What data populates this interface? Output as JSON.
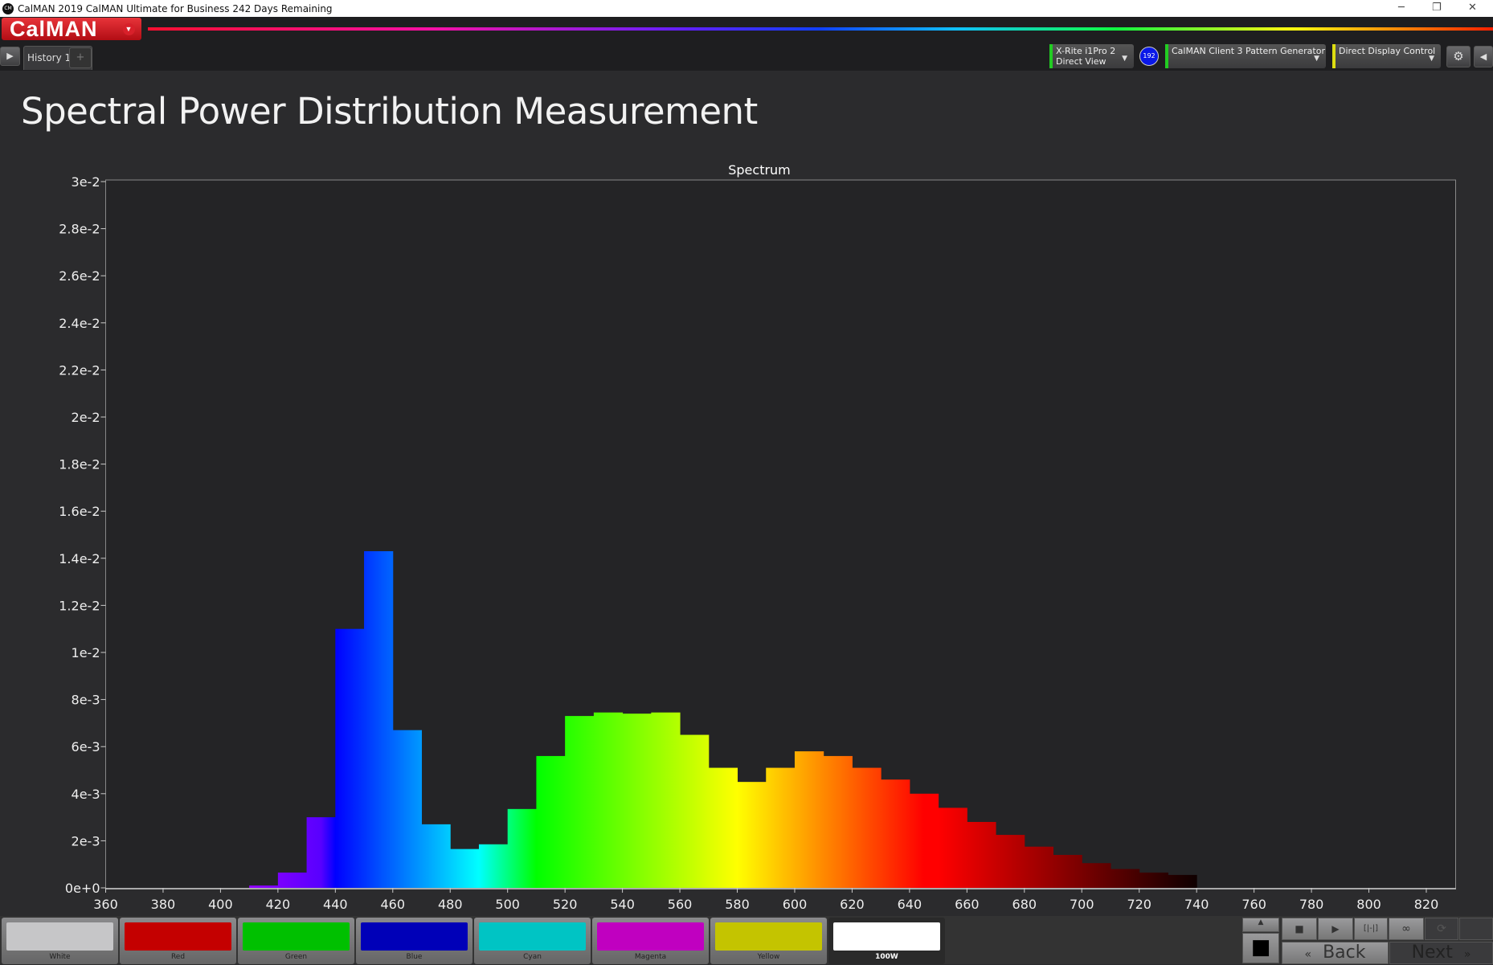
{
  "window": {
    "title": "CalMAN 2019 CalMAN Ultimate for Business 242 Days Remaining",
    "logo_text": "CM",
    "minimize": "─",
    "restore": "❐",
    "close": "✕"
  },
  "app": {
    "brand": "CalMAN",
    "brand_dropdown": "▼"
  },
  "tabs": {
    "play": "▶",
    "items": [
      {
        "label": "History 1"
      }
    ],
    "add": "+"
  },
  "devices": [
    {
      "line1": "X-Rite i1Pro 2",
      "line2": "Direct View",
      "status_color": "#22cc22"
    },
    {
      "line1": "CalMAN Client 3 Pattern Generator",
      "line2": "",
      "status_color": "#22cc22"
    },
    {
      "line1": "Direct Display Control",
      "line2": "",
      "status_color": "#dddd11"
    }
  ],
  "meter_badge": "192",
  "page_title": "Spectral Power Distribution Measurement",
  "chart_data": {
    "type": "bar",
    "title": "Spectrum",
    "xlabel": "",
    "ylabel": "",
    "xlim": [
      360,
      830
    ],
    "ylim": [
      0,
      0.03
    ],
    "x_ticks": [
      "360",
      "380",
      "400",
      "420",
      "440",
      "460",
      "480",
      "500",
      "520",
      "540",
      "560",
      "580",
      "600",
      "620",
      "640",
      "660",
      "680",
      "700",
      "720",
      "740",
      "760",
      "780",
      "800",
      "820"
    ],
    "y_ticks": [
      "0e+0",
      "2e-3",
      "4e-3",
      "6e-3",
      "8e-3",
      "1e-2",
      "1.2e-2",
      "1.4e-2",
      "1.6e-2",
      "1.8e-2",
      "2e-2",
      "2.2e-2",
      "2.4e-2",
      "2.6e-2",
      "2.8e-2",
      "3e-2"
    ],
    "bin_width_nm": 10,
    "bin_start_nm": [
      410,
      420,
      430,
      440,
      450,
      460,
      470,
      480,
      490,
      500,
      510,
      520,
      530,
      540,
      550,
      560,
      570,
      580,
      590,
      600,
      610,
      620,
      630,
      640,
      650,
      660,
      670,
      680,
      690,
      700,
      710,
      720,
      730
    ],
    "values": [
      0.0001,
      0.00065,
      0.003,
      0.011,
      0.0143,
      0.0067,
      0.0027,
      0.00165,
      0.00185,
      0.00335,
      0.0056,
      0.0073,
      0.00745,
      0.0074,
      0.00745,
      0.0065,
      0.0051,
      0.0045,
      0.0051,
      0.0058,
      0.0056,
      0.0051,
      0.0046,
      0.004,
      0.0034,
      0.0028,
      0.00225,
      0.00175,
      0.0014,
      0.00105,
      0.0008,
      0.00065,
      0.00055
    ],
    "grid": false
  },
  "swatches": [
    {
      "label": "White",
      "color": "#c6c6c8"
    },
    {
      "label": "Red",
      "color": "#c40000"
    },
    {
      "label": "Green",
      "color": "#00c000"
    },
    {
      "label": "Blue",
      "color": "#0000b8"
    },
    {
      "label": "Cyan",
      "color": "#00c4c4"
    },
    {
      "label": "Magenta",
      "color": "#c000c0"
    },
    {
      "label": "Yellow",
      "color": "#c4c400"
    },
    {
      "label": "100W",
      "color": "#ffffff",
      "selected": true
    }
  ],
  "controls": {
    "up": "▲",
    "stop_big": "■",
    "stop": "■",
    "play": "▶",
    "fit": "[|-|]",
    "loop": "∞",
    "refresh": "⟳",
    "back": "Back",
    "back_icon": "«",
    "next": "Next",
    "next_icon": "»"
  }
}
